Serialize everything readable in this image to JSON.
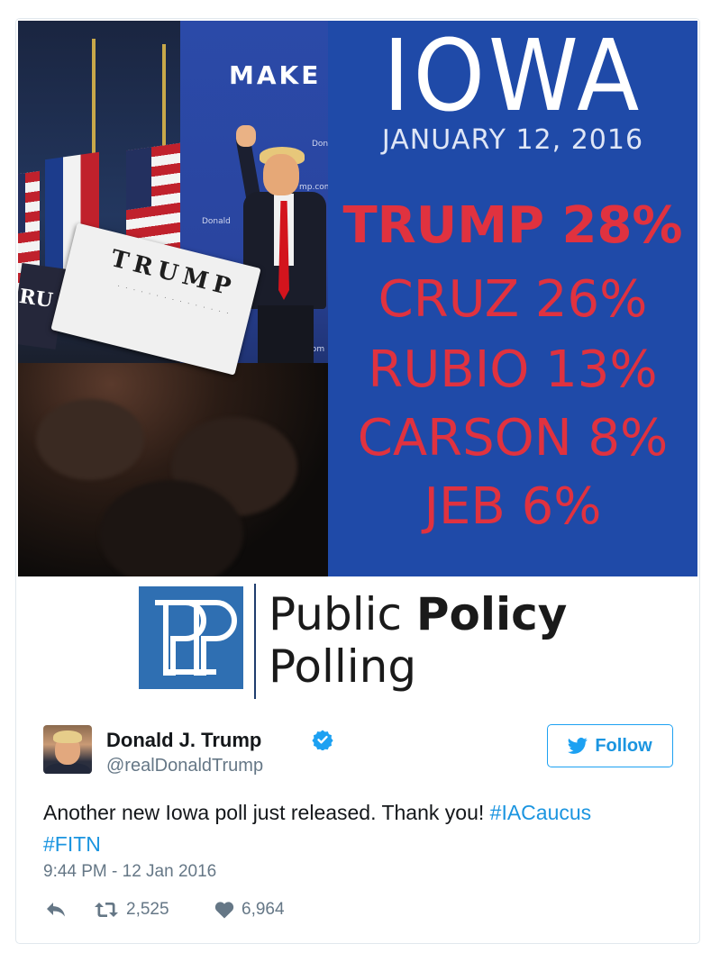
{
  "media": {
    "photo": {
      "backdrop_text": "MAKE",
      "sign_text": "TRUMP",
      "sign_left_text": "RU",
      "banner_texts": [
        "Donald",
        "mp.com",
        "Donald",
        ".com"
      ]
    },
    "poll": {
      "state": "IOWA",
      "date": "JANUARY 12, 2016",
      "results": [
        {
          "text": "TRUMP 28%",
          "candidate": "TRUMP",
          "percent": 28
        },
        {
          "text": "CRUZ 26%",
          "candidate": "CRUZ",
          "percent": 26
        },
        {
          "text": "RUBIO 13%",
          "candidate": "RUBIO",
          "percent": 13
        },
        {
          "text": "CARSON 8%",
          "candidate": "CARSON",
          "percent": 8
        },
        {
          "text": "JEB 6%",
          "candidate": "JEB",
          "percent": 6
        }
      ],
      "panel_color": "#1f4aa8",
      "result_color": "#e0323f"
    },
    "logo": {
      "line1_regular": "Public",
      "line1_bold": "Policy",
      "line2": "Polling",
      "mark_color": "#2f6fb2"
    }
  },
  "tweet": {
    "author": {
      "display_name": "Donald J. Trump",
      "handle": "@realDonaldTrump",
      "verified": true
    },
    "follow_label": "Follow",
    "text": "Another new Iowa poll just released. Thank you! ",
    "hashtags": [
      "#IACaucus",
      "#FITN"
    ],
    "timestamp": "9:44 PM - 12 Jan 2016",
    "retweets": "2,525",
    "likes": "6,964",
    "accent_color": "#1b95e0"
  }
}
